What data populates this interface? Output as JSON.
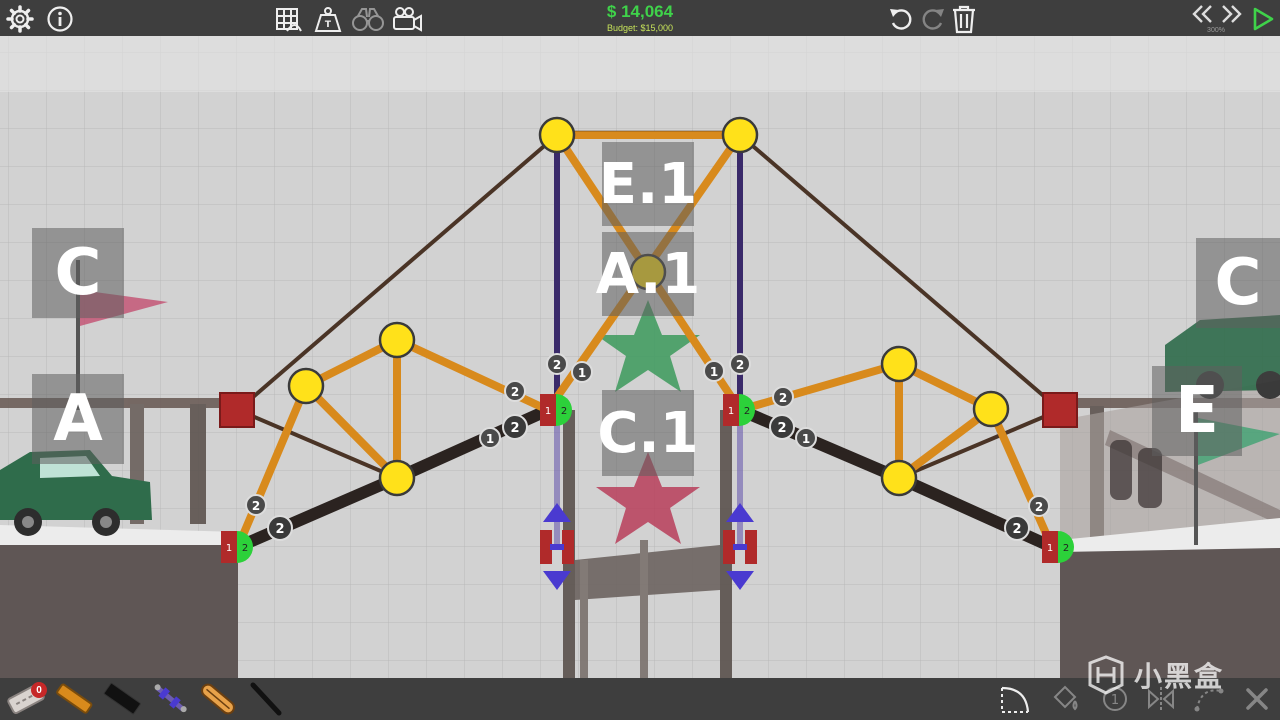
{
  "toolbar": {
    "money": "$ 14,064",
    "budget": "Budget: $15,000",
    "speed": "300%"
  },
  "checkpoints": {
    "c_left": "C",
    "a_left": "A",
    "e1": "E.1",
    "a1": "A.1",
    "c1": "C.1",
    "c_right": "C",
    "e_right": "E"
  },
  "materials": {
    "road_count": "0"
  },
  "watermark": {
    "text": "小黑盒"
  },
  "colors": {
    "accent_green": "#3fd24a",
    "wood": "#d88a1c",
    "steel": "#2b2320",
    "hydraulic": "#3a2a6a",
    "joint": "#ffe11a",
    "anchor": "#b02a2a"
  }
}
